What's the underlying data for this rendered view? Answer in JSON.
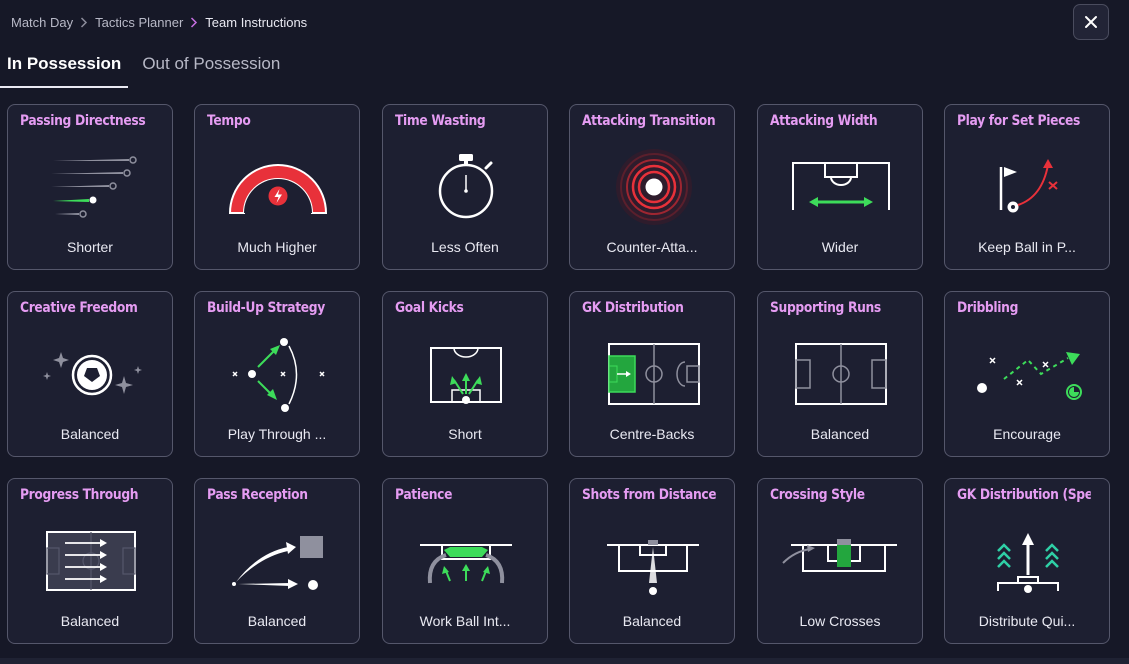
{
  "breadcrumb": [
    "Match Day",
    "Tactics Planner",
    "Team Instructions"
  ],
  "tabs": [
    {
      "label": "In Possession",
      "active": true
    },
    {
      "label": "Out of Possession",
      "active": false
    }
  ],
  "colors": {
    "accent_title": "#e59cf2",
    "green": "#3ddc5a",
    "red": "#e8313a",
    "card_bg": "#1d1f31",
    "card_border": "#55576b",
    "page_bg": "#161827"
  },
  "cards": [
    {
      "title": "Passing Directness",
      "value": "Shorter",
      "icon": "passing-directness-icon"
    },
    {
      "title": "Tempo",
      "value": "Much Higher",
      "icon": "tempo-gauge-icon"
    },
    {
      "title": "Time Wasting",
      "value": "Less Often",
      "icon": "stopwatch-icon"
    },
    {
      "title": "Attacking Transition",
      "value": "Counter-Atta...",
      "icon": "counter-attack-icon"
    },
    {
      "title": "Attacking Width",
      "value": "Wider",
      "icon": "attacking-width-icon"
    },
    {
      "title": "Play for Set Pieces",
      "value": "Keep Ball in P...",
      "icon": "set-pieces-icon"
    },
    {
      "title": "Creative Freedom",
      "value": "Balanced",
      "icon": "creative-freedom-icon"
    },
    {
      "title": "Build-Up Strategy",
      "value": "Play Through ...",
      "icon": "build-up-icon"
    },
    {
      "title": "Goal Kicks",
      "value": "Short",
      "icon": "goal-kicks-icon"
    },
    {
      "title": "GK Distribution",
      "value": "Centre-Backs",
      "icon": "gk-distribution-icon"
    },
    {
      "title": "Supporting Runs",
      "value": "Balanced",
      "icon": "supporting-runs-icon"
    },
    {
      "title": "Dribbling",
      "value": "Encourage",
      "icon": "dribbling-icon"
    },
    {
      "title": "Progress Through",
      "value": "Balanced",
      "icon": "progress-through-icon"
    },
    {
      "title": "Pass Reception",
      "value": "Balanced",
      "icon": "pass-reception-icon"
    },
    {
      "title": "Patience",
      "value": "Work Ball Int...",
      "icon": "patience-icon"
    },
    {
      "title": "Shots from Distance",
      "value": "Balanced",
      "icon": "shots-distance-icon"
    },
    {
      "title": "Crossing Style",
      "value": "Low Crosses",
      "icon": "crossing-style-icon"
    },
    {
      "title": "GK Distribution (Speed",
      "value": "Distribute Qui...",
      "icon": "gk-speed-icon"
    }
  ]
}
